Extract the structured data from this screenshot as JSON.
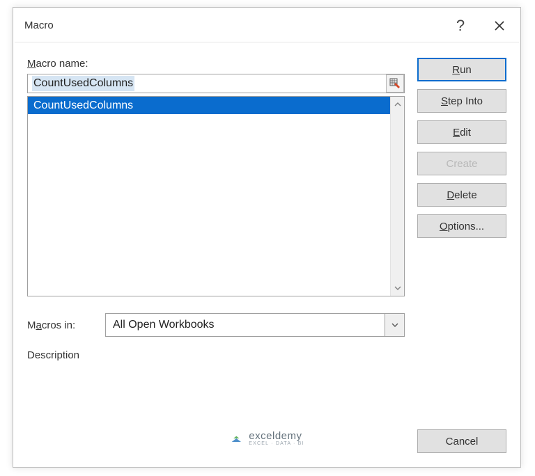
{
  "dialog": {
    "title": "Macro",
    "help_label": "?",
    "close_label": "Close"
  },
  "labels": {
    "macro_name": "Macro name:",
    "macros_in": "Macros in:",
    "description": "Description"
  },
  "fields": {
    "macro_name_value": "CountUsedColumns",
    "macros_in_value": "All Open Workbooks"
  },
  "macro_list": [
    "CountUsedColumns"
  ],
  "buttons": {
    "run": "Run",
    "step_into": "Step Into",
    "edit": "Edit",
    "create": "Create",
    "delete": "Delete",
    "options": "Options...",
    "cancel": "Cancel"
  },
  "watermark": {
    "brand": "exceldemy",
    "tagline": "EXCEL · DATA · BI"
  }
}
